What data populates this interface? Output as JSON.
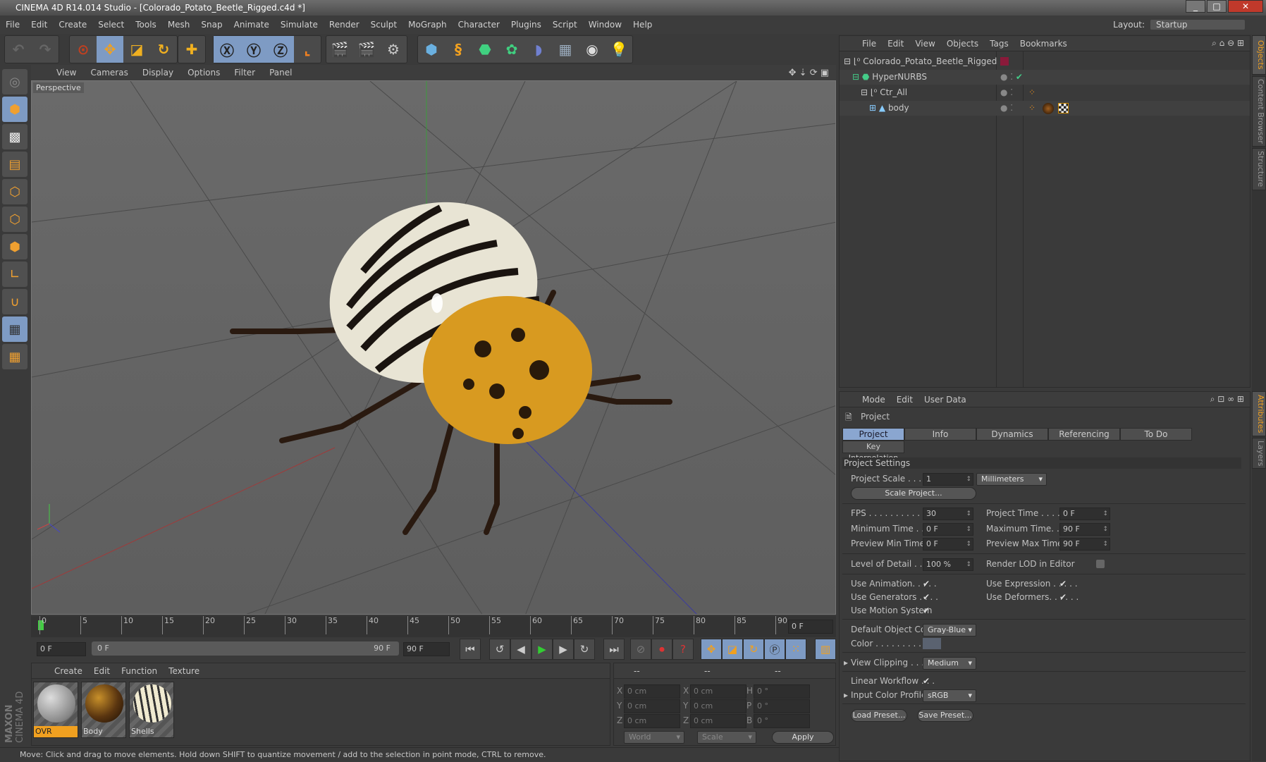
{
  "window": {
    "title": "CINEMA 4D R14.014 Studio - [Colorado_Potato_Beetle_Rigged.c4d *]"
  },
  "menu": [
    "File",
    "Edit",
    "Create",
    "Select",
    "Tools",
    "Mesh",
    "Snap",
    "Animate",
    "Simulate",
    "Render",
    "Sculpt",
    "MoGraph",
    "Character",
    "Plugins",
    "Script",
    "Window",
    "Help"
  ],
  "layout": {
    "label": "Layout:",
    "value": "Startup"
  },
  "viewport": {
    "menu": [
      "View",
      "Cameras",
      "Display",
      "Options",
      "Filter",
      "Panel"
    ],
    "camera_label": "Perspective"
  },
  "timeline": {
    "ticks": [
      "0",
      "5",
      "10",
      "15",
      "20",
      "25",
      "30",
      "35",
      "40",
      "45",
      "50",
      "55",
      "60",
      "65",
      "70",
      "75",
      "80",
      "85",
      "90"
    ],
    "current_frame": "0 F",
    "start_field": "0 F",
    "range_start": "0 F",
    "range_end": "90 F",
    "end_field": "90 F"
  },
  "materials": {
    "menu": [
      "Create",
      "Edit",
      "Function",
      "Texture"
    ],
    "items": [
      {
        "name": "OVR"
      },
      {
        "name": "Body"
      },
      {
        "name": "Shells"
      }
    ]
  },
  "coords": {
    "headers": [
      "--",
      "--",
      "--"
    ],
    "rows": [
      [
        "X",
        "0 cm",
        "X",
        "0 cm",
        "H",
        "0 °"
      ],
      [
        "Y",
        "0 cm",
        "Y",
        "0 cm",
        "P",
        "0 °"
      ],
      [
        "Z",
        "0 cm",
        "Z",
        "0 cm",
        "B",
        "0 °"
      ]
    ],
    "space": "World",
    "mode": "Scale",
    "apply": "Apply"
  },
  "status": "Move: Click and drag to move elements. Hold down SHIFT to quantize movement / add to the selection in point mode, CTRL to remove.",
  "brand": "MAXON CINEMA 4D",
  "objects": {
    "menu": [
      "File",
      "Edit",
      "View",
      "Objects",
      "Tags",
      "Bookmarks"
    ],
    "tree": [
      {
        "name": "Colorado_Potato_Beetle_Rigged"
      },
      {
        "name": "HyperNURBS"
      },
      {
        "name": "Ctr_All"
      },
      {
        "name": "body"
      }
    ]
  },
  "attributes": {
    "menu": [
      "Mode",
      "Edit",
      "User Data"
    ],
    "title": "Project",
    "tabs": [
      "Project Settings",
      "Info",
      "Dynamics",
      "Referencing",
      "To Do",
      "Key Interpolation"
    ],
    "section": "Project Settings",
    "project_scale": {
      "label": "Project Scale . . . . . .",
      "value": "1",
      "unit": "Millimeters"
    },
    "scale_button": "Scale Project...",
    "fps": {
      "label": "FPS . . . . . . . . . . . . . .",
      "value": "30"
    },
    "project_time": {
      "label": "Project Time . . . . . . . .",
      "value": "0 F"
    },
    "min_time": {
      "label": "Minimum Time . . . . .",
      "value": "0 F"
    },
    "max_time": {
      "label": "Maximum Time. . . . . .",
      "value": "90 F"
    },
    "prev_min": {
      "label": "Preview Min Time . .",
      "value": "0 F"
    },
    "prev_max": {
      "label": "Preview Max Time . . .",
      "value": "90 F"
    },
    "lod": {
      "label": "Level of Detail . . . . .",
      "value": "100 %"
    },
    "render_lod": "Render LOD in Editor",
    "use_animation": "Use Animation. . . . .",
    "use_expression": "Use Expression . . . . .",
    "use_generators": "Use Generators . . . .",
    "use_deformers": "Use Deformers. . . . . .",
    "use_motion": "Use Motion System",
    "default_color": {
      "label": "Default Object Color",
      "value": "Gray-Blue"
    },
    "color_label": "Color . . . . . . . . . . .",
    "view_clipping": {
      "label": "View Clipping . . . . .",
      "value": "Medium"
    },
    "linear_workflow": "Linear Workflow . . .",
    "input_profile": {
      "label": "Input Color Profile .",
      "value": "sRGB"
    },
    "load_preset": "Load Preset...",
    "save_preset": "Save Preset...",
    "check": "✔"
  },
  "side_tabs": [
    "Objects",
    "Content Browser",
    "Structure",
    "Attributes",
    "Layers"
  ]
}
